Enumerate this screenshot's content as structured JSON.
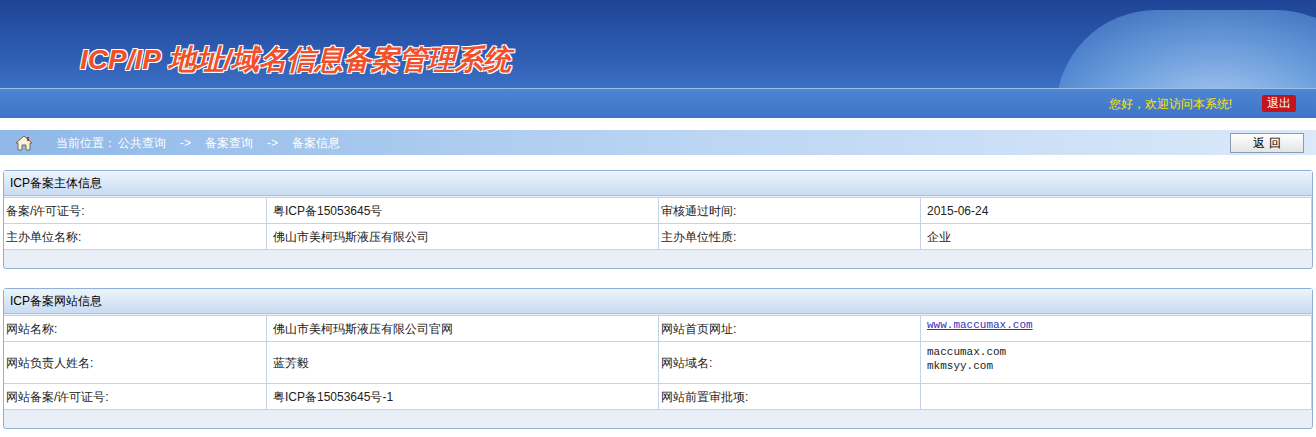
{
  "header": {
    "title": "ICP/IP 地址/域名信息备案管理系统",
    "welcome": "您好，欢迎访问本系统!",
    "logout": "退出"
  },
  "breadcrumb": {
    "label": "当前位置：",
    "items": [
      "公共查询",
      "备案查询",
      "备案信息"
    ],
    "separator": "->",
    "back": "返 回"
  },
  "sections": [
    {
      "title": "ICP备案主体信息",
      "rows": [
        [
          {
            "label": "备案/许可证号:",
            "values": [
              "粤ICP备15053645号"
            ],
            "kind": "text"
          },
          {
            "label": "审核通过时间:",
            "values": [
              "2015-06-24"
            ],
            "kind": "text"
          }
        ],
        [
          {
            "label": "主办单位名称:",
            "values": [
              "佛山市美柯玛斯液压有限公司"
            ],
            "kind": "text"
          },
          {
            "label": "主办单位性质:",
            "values": [
              "企业"
            ],
            "kind": "text"
          }
        ]
      ]
    },
    {
      "title": "ICP备案网站信息",
      "rows": [
        [
          {
            "label": "网站名称:",
            "values": [
              "佛山市美柯玛斯液压有限公司官网"
            ],
            "kind": "text"
          },
          {
            "label": "网站首页网址:",
            "values": [
              "www.maccumax.com"
            ],
            "kind": "link"
          }
        ],
        [
          {
            "label": "网站负责人姓名:",
            "values": [
              "蓝芳毅"
            ],
            "kind": "text"
          },
          {
            "label": "网站域名:",
            "values": [
              "maccumax.com",
              "mkmsyy.com"
            ],
            "kind": "domain"
          }
        ],
        [
          {
            "label": "网站备案/许可证号:",
            "values": [
              "粤ICP备15053645号-1"
            ],
            "kind": "text"
          },
          {
            "label": "网站前置审批项:",
            "values": [],
            "kind": "text"
          }
        ]
      ]
    }
  ]
}
